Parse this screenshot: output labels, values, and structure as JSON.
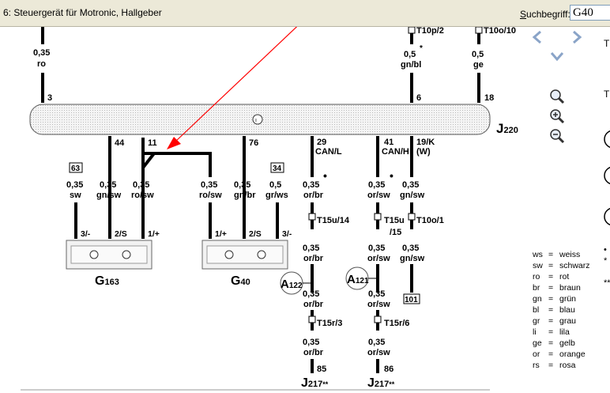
{
  "window": {
    "title": "6: Steuergerät für Motronic, Hallgeber"
  },
  "search": {
    "label_prefix": "S",
    "label_rest": "uchbegriff:",
    "value": "G40"
  },
  "diagram": {
    "wires_top": [
      {
        "gauge": "0,35",
        "color": "ro",
        "pin": "3"
      },
      {
        "gauge": "0,5",
        "color": "gn/bl",
        "pin": "6",
        "connector": "T10p/2",
        "mark": "*"
      },
      {
        "gauge": "0,5",
        "color": "ge",
        "pin": "18",
        "connector": "T10o/10"
      }
    ],
    "ecu": {
      "label": "J",
      "sub": "220"
    },
    "ecu_pins": [
      "44",
      "11",
      "76",
      "29",
      "41",
      "19/K"
    ],
    "ecu_pin_notes": [
      "CAN/L",
      "CAN/H",
      "(W)"
    ],
    "wires_bottom": [
      {
        "gauge": "0,35",
        "color": "sw",
        "box": "63",
        "pin": "3/-"
      },
      {
        "gauge": "0,35",
        "color": "gn/sw",
        "pin": "2/S"
      },
      {
        "gauge": "0,35",
        "color": "ro/sw",
        "pin": "1/+"
      },
      {
        "gauge": "0,35",
        "color": "ro/sw",
        "pin": "1/+"
      },
      {
        "gauge": "0,35",
        "color": "gn/br",
        "pin": "2/S"
      },
      {
        "gauge": "0,5",
        "color": "gr/ws",
        "box": "34",
        "pin": "3/-"
      }
    ],
    "sensors": [
      {
        "label": "G",
        "sub": "163"
      },
      {
        "label": "G",
        "sub": "40"
      }
    ],
    "can_l": {
      "gauges": [
        "0,35",
        "0,35",
        "0,35",
        "0,35"
      ],
      "colors": [
        "or/br",
        "or/br",
        "or/br",
        "or/br"
      ],
      "connectors": [
        "T15u/14",
        "T15r/3"
      ],
      "splice": {
        "label": "A",
        "sub": "122"
      },
      "pin": "85",
      "target": {
        "label": "J",
        "sub": "217",
        "mark": "**"
      }
    },
    "can_h": {
      "gauges": [
        "0,35",
        "0,35",
        "0,35",
        "0,35"
      ],
      "colors": [
        "or/sw",
        "or/sw",
        "or/sw",
        "or/sw"
      ],
      "connectors": [
        "T15u",
        "/15",
        "T15r/6"
      ],
      "splice": {
        "label": "A",
        "sub": "121"
      },
      "pin": "86",
      "target": {
        "label": "J",
        "sub": "217",
        "mark": "**"
      }
    },
    "w_line": {
      "gauges": [
        "0,35",
        "0,35"
      ],
      "colors": [
        "gn/sw",
        "gn/sw"
      ],
      "connector": "T10o/1",
      "box": "101"
    },
    "colors": {
      "wire": "#000000",
      "arrow": "#ff0000",
      "ecu_fill": "#eeeeee"
    }
  },
  "legend": [
    {
      "abbr": "ws",
      "name": "weiss"
    },
    {
      "abbr": "sw",
      "name": "schwarz"
    },
    {
      "abbr": "ro",
      "name": "rot"
    },
    {
      "abbr": "br",
      "name": "braun"
    },
    {
      "abbr": "gn",
      "name": "grün"
    },
    {
      "abbr": "bl",
      "name": "blau"
    },
    {
      "abbr": "gr",
      "name": "grau"
    },
    {
      "abbr": "li",
      "name": "lila"
    },
    {
      "abbr": "ge",
      "name": "gelb"
    },
    {
      "abbr": "or",
      "name": "orange"
    },
    {
      "abbr": "rs",
      "name": "rosa"
    }
  ],
  "legend_eq": "=",
  "side_panel": {
    "letters": [
      "T",
      "T"
    ],
    "marks": [
      "•",
      "*",
      "**"
    ],
    "icons": [
      "chevron-left-icon",
      "chevron-right-icon",
      "chevron-down-icon",
      "magnifier-icon",
      "zoom-in-icon",
      "zoom-out-icon"
    ]
  }
}
